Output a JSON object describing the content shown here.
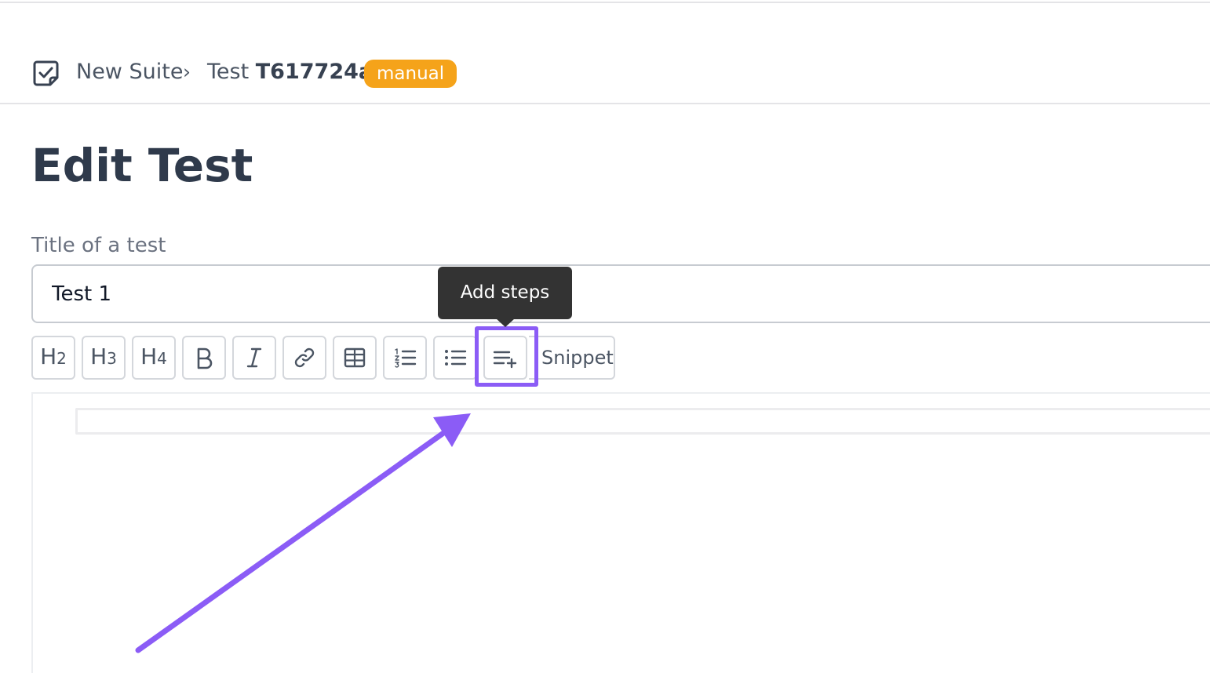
{
  "breadcrumb": {
    "suite_icon": "checklist-icon",
    "suite": "New Suite",
    "separator": "›",
    "test_prefix": "Test ",
    "test_id": "T617724ac",
    "badge": "manual"
  },
  "page": {
    "title": "Edit Test"
  },
  "form": {
    "title_label": "Title of a test",
    "title_value": "Test 1"
  },
  "toolbar": {
    "buttons": [
      {
        "name": "heading-2",
        "label": "H",
        "sub": "2"
      },
      {
        "name": "heading-3",
        "label": "H",
        "sub": "3"
      },
      {
        "name": "heading-4",
        "label": "H",
        "sub": "4"
      },
      {
        "name": "bold",
        "icon": "bold-icon"
      },
      {
        "name": "italic",
        "icon": "italic-icon"
      },
      {
        "name": "link",
        "icon": "link-icon"
      },
      {
        "name": "table",
        "icon": "table-icon"
      },
      {
        "name": "ordered-list",
        "icon": "ordered-list-icon"
      },
      {
        "name": "bullet-list",
        "icon": "bullet-list-icon"
      },
      {
        "name": "add-steps",
        "icon": "add-steps-icon"
      }
    ],
    "snippet_label": "Snippet"
  },
  "tooltip": {
    "text": "Add steps"
  },
  "colors": {
    "badge": "#f5a31a",
    "highlight": "#8b5cf6",
    "tooltip_bg": "#333333",
    "text": "#2f3a4b"
  }
}
